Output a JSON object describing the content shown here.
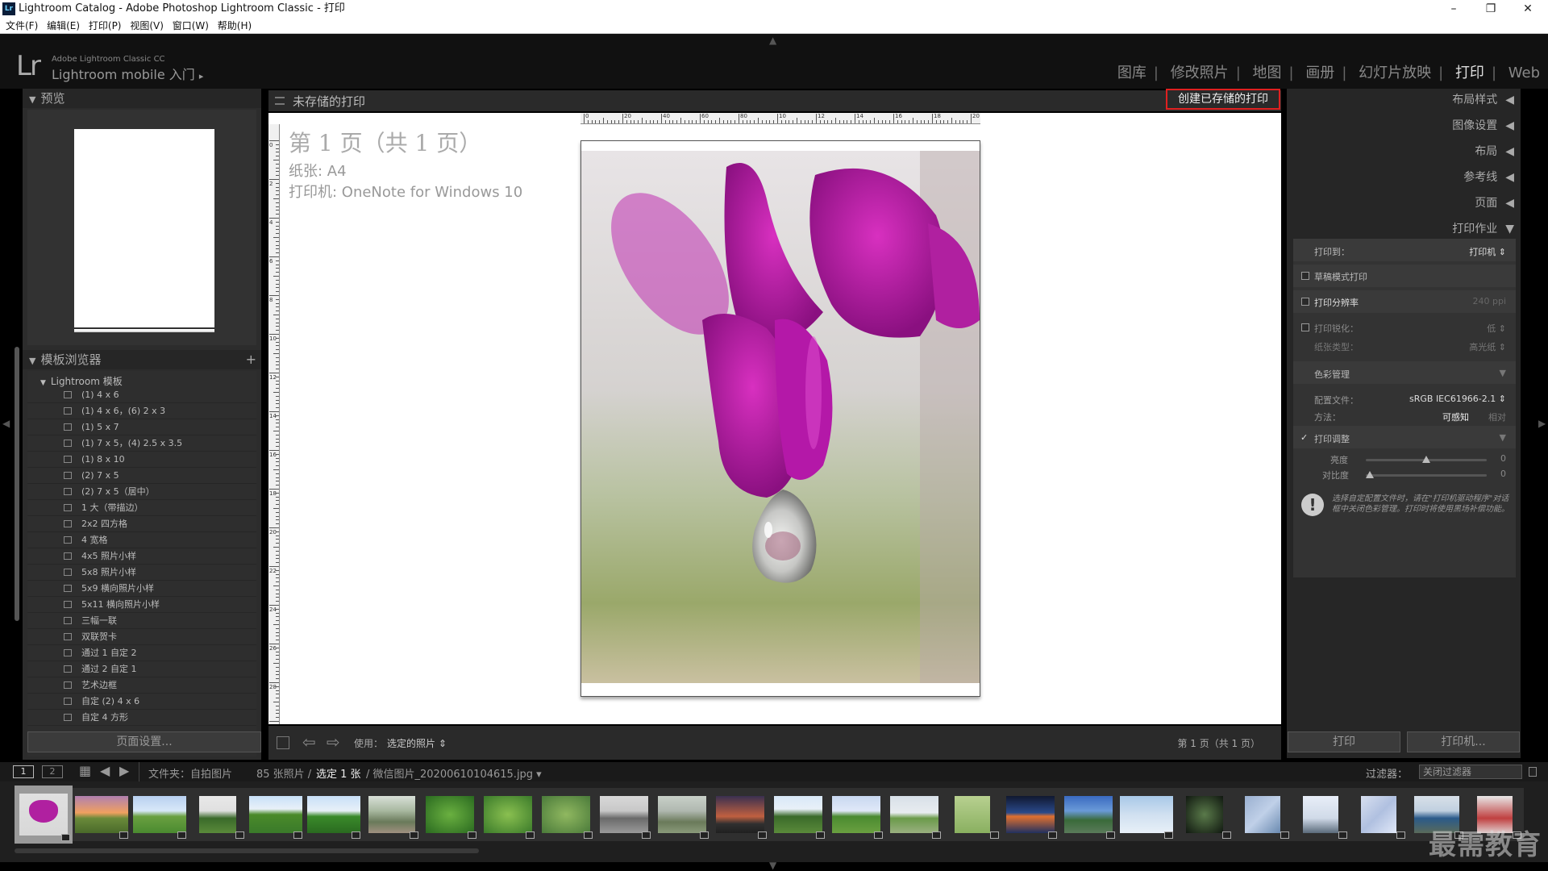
{
  "titlebar": {
    "title": "Lightroom Catalog - Adobe Photoshop Lightroom Classic - 打印",
    "min": "–",
    "max": "❐",
    "close": "✕"
  },
  "menu": [
    "文件(F)",
    "编辑(E)",
    "打印(P)",
    "视图(V)",
    "窗口(W)",
    "帮助(H)"
  ],
  "identity": {
    "logo": "Lr",
    "line1": "Adobe Lightroom Classic CC",
    "line2": "Lightroom mobile 入门",
    "arrow": "▸"
  },
  "modules": [
    "图库",
    "修改照片",
    "地图",
    "画册",
    "幻灯片放映",
    "打印",
    "Web"
  ],
  "active_module": "打印",
  "left": {
    "preview_title": "预览",
    "template_title": "模板浏览器",
    "group": "Lightroom 模板",
    "templates": [
      "(1) 4 x 6",
      "(1) 4 x 6，(6) 2 x 3",
      "(1) 5 x 7",
      "(1) 7 x 5，(4) 2.5 x 3.5",
      "(1) 8 x 10",
      "(2) 7 x 5",
      "(2) 7 x 5（居中）",
      "1 大（带描边）",
      "2x2 四方格",
      "4 宽格",
      "4x5 照片小样",
      "5x8 照片小样",
      "5x9 横向照片小样",
      "5x11 横向照片小样",
      "三幅一联",
      "双联贺卡",
      "通过 1 自定 2",
      "通过 2 自定 1",
      "艺术边框",
      "自定 (2) 4 x 6",
      "自定 4 方形"
    ],
    "page_setup": "页面设置..."
  },
  "center": {
    "header": "未存储的打印",
    "save_button": "创建已存储的打印",
    "page_line1": "第 1 页（共 1 页）",
    "page_line2": "纸张: A4",
    "page_line3": "打印机: OneNote for Windows 10",
    "ruler_labels": [
      "0",
      "20",
      "40",
      "60",
      "80",
      "10",
      "12",
      "14",
      "16",
      "18",
      "20"
    ],
    "left_ruler_labels": [
      "0",
      "2",
      "4",
      "6",
      "8",
      "10",
      "12",
      "14",
      "16",
      "18",
      "20",
      "22",
      "24",
      "26",
      "28"
    ],
    "footer_use": "使用：",
    "footer_use_value": "选定的照片 ⇕",
    "footer_pageinfo": "第 1 页（共 1 页）"
  },
  "right": {
    "sections": [
      "布局样式",
      "图像设置",
      "布局",
      "参考线",
      "页面",
      "打印作业"
    ],
    "print_to_label": "打印到：",
    "print_to_value": "打印机 ⇕",
    "draft": "草稿模式打印",
    "resolution": "打印分辨率",
    "resolution_value": "240 ppi",
    "sharpen": "打印锐化：",
    "sharpen_value": "低 ⇕",
    "media": "纸张类型：",
    "media_value": "高光纸 ⇕",
    "color_mgmt": "色彩管理",
    "profile_label": "配置文件：",
    "profile_value": "sRGB IEC61966-2.1 ⇕",
    "intent_label": "方法：",
    "intent_perceptual": "可感知",
    "intent_relative": "相对",
    "adjust": "打印调整",
    "brightness": "亮度",
    "contrast": "对比度",
    "brightness_value": "0",
    "contrast_value": "0",
    "note": "选择自定配置文件时，请在\"打印机驱动程序\"对话框中关闭色彩管理。打印时将使用黑场补偿功能。",
    "print_btn": "打印",
    "printer_btn": "打印机..."
  },
  "filmbar": {
    "folder": "文件夹：自拍图片",
    "count": "85 张照片 /",
    "selected": "选定 1 张",
    "file": "/ 微信图片_20200610104615.jpg ▾",
    "filter_label": "过滤器：",
    "filter_value": "关闭过滤器"
  },
  "watermark": "最需教育"
}
